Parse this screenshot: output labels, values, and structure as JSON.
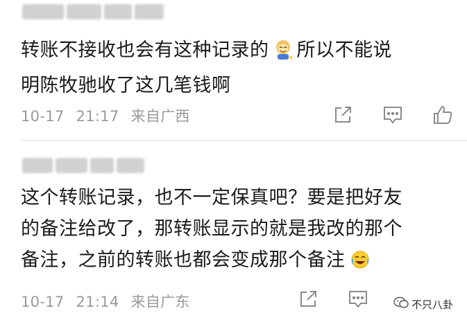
{
  "comments": [
    {
      "username_redacted": true,
      "text_line1": "转账不接收也会有这种记录的",
      "text_line1_after_emoji": "所以不能说",
      "text_line2": "明陈牧驰收了这几笔钱啊",
      "emoji": "smiling-face-emoji",
      "date": "10-17",
      "time": "21:17",
      "location": "来自广西",
      "actions": [
        "share-icon",
        "comment-icon",
        "like-icon"
      ]
    },
    {
      "username_redacted": true,
      "text_line1": "这个转账记录，也不一定保真吧？要是把好友",
      "text_line2": "的备注给改了，那转账显示的就是我改的那个",
      "text_line3": "备注，之前的转账也都会变成那个备注",
      "emoji": "laughing-crying-emoji",
      "date": "10-17",
      "time": "21:14",
      "location": "来自广东",
      "actions": [
        "share-icon",
        "comment-icon"
      ]
    }
  ],
  "watermark": {
    "icon": "wechat-icon",
    "text": "不只八卦"
  },
  "colors": {
    "text": "#1a1a1a",
    "meta": "#9a9a9a",
    "divider": "#e6e6e6",
    "icon": "#8a8a8a"
  }
}
